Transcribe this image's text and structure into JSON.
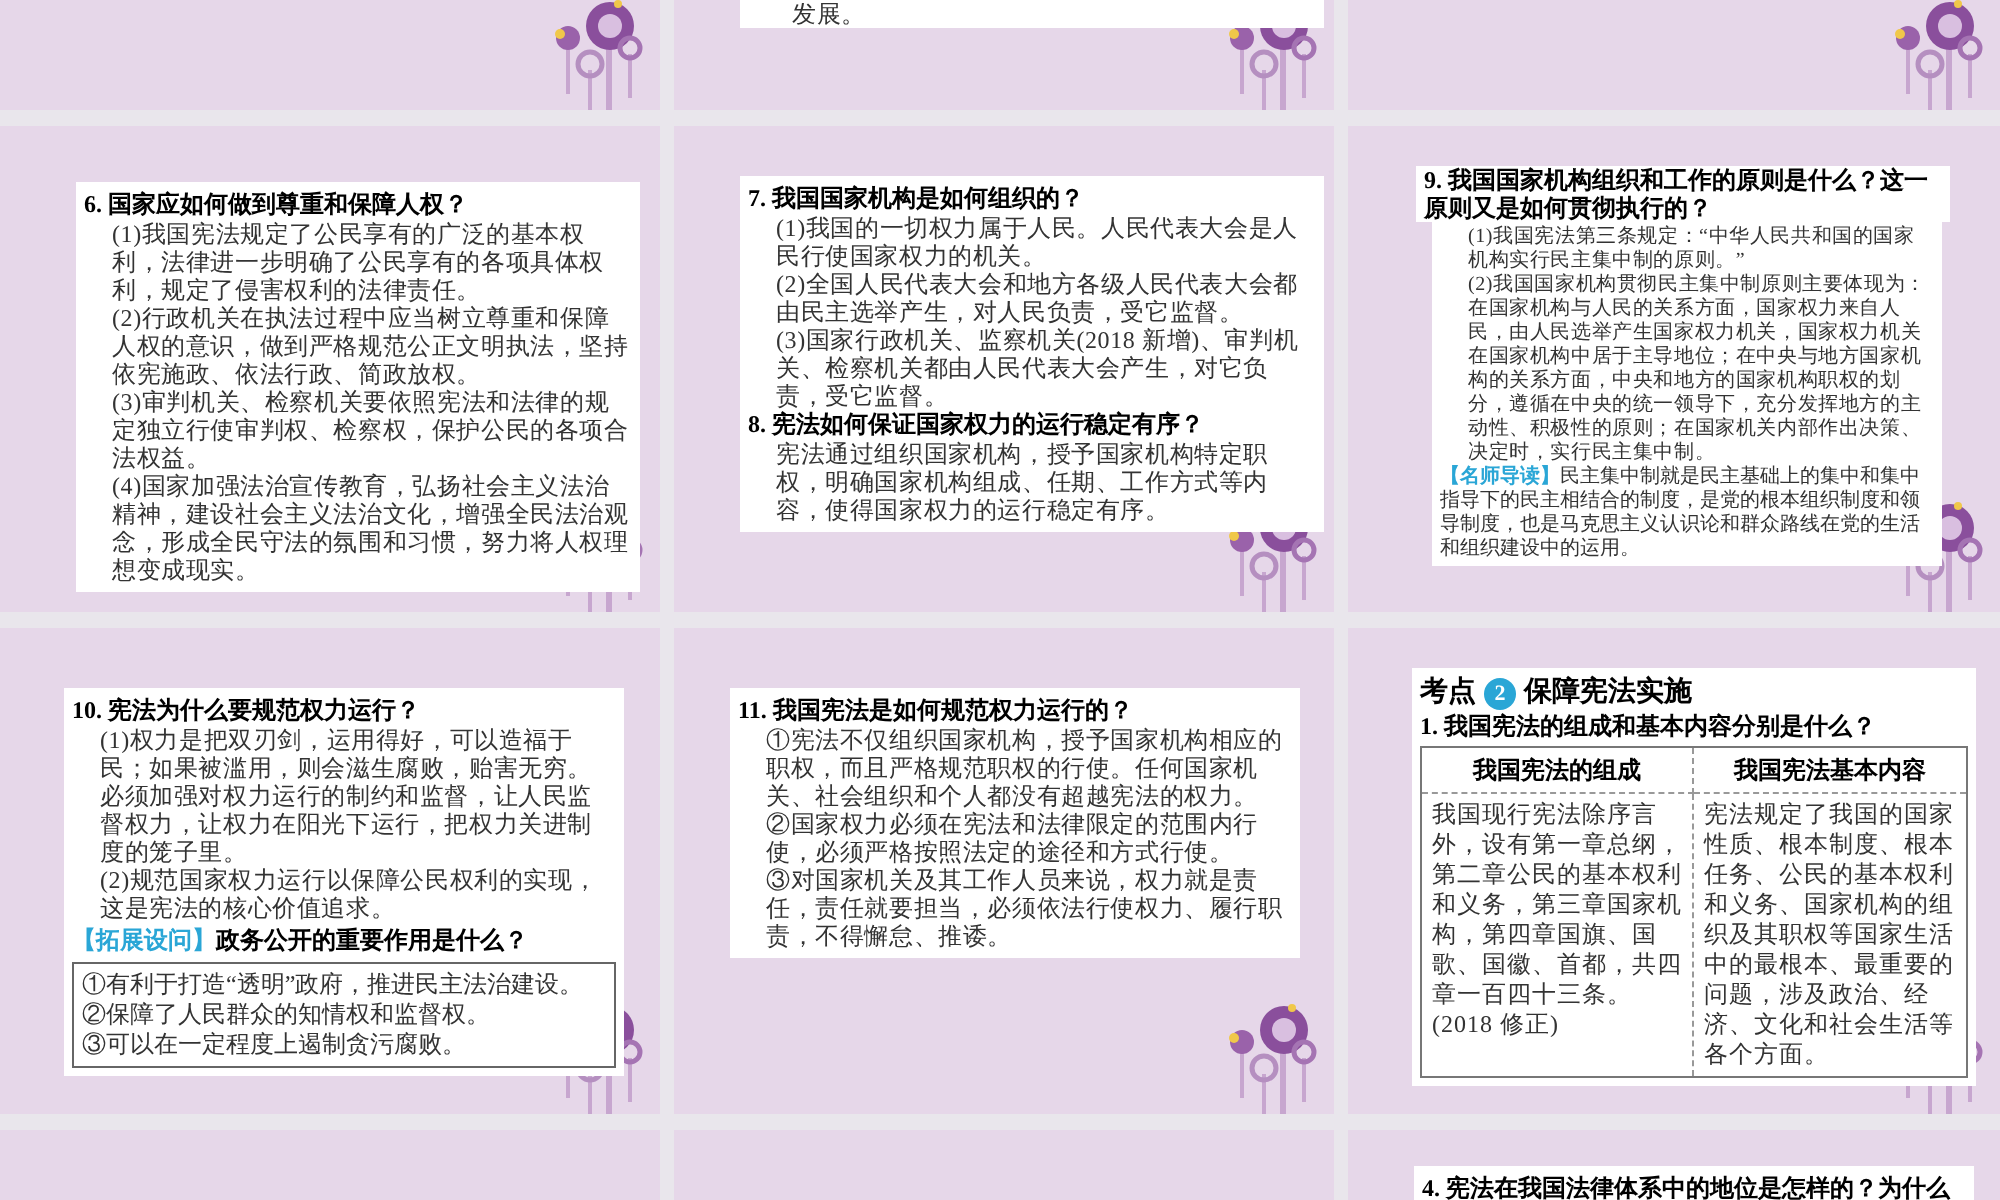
{
  "slides": [
    {
      "flower": true
    },
    {
      "flower": true,
      "blocks": [
        {
          "kind": "paragraph",
          "text": "发展。"
        }
      ]
    },
    {
      "flower": true
    },
    {
      "flower": true,
      "blocks": [
        {
          "kind": "question",
          "text": "6. 国家应如何做到尊重和保障人权？"
        },
        {
          "kind": "paragraph",
          "text": "(1)我国宪法规定了公民享有的广泛的基本权利，法律进一步明确了公民享有的各项具体权利，规定了侵害权利的法律责任。"
        },
        {
          "kind": "paragraph",
          "text": "(2)行政机关在执法过程中应当树立尊重和保障人权的意识，做到严格规范公正文明执法，坚持依宪施政、依法行政、简政放权。"
        },
        {
          "kind": "paragraph",
          "text": "(3)审判机关、检察机关要依照宪法和法律的规定独立行使审判权、检察权，保护公民的各项合法权益。"
        },
        {
          "kind": "paragraph",
          "text": "(4)国家加强法治宣传教育，弘扬社会主义法治精神，建设社会主义法治文化，增强全民法治观念，形成全民守法的氛围和习惯，努力将人权理想变成现实。"
        }
      ]
    },
    {
      "flower": true,
      "blocks": [
        {
          "kind": "question",
          "text": "7. 我国国家机构是如何组织的？"
        },
        {
          "kind": "paragraph",
          "text": "(1)我国的一切权力属于人民。人民代表大会是人民行使国家权力的机关。"
        },
        {
          "kind": "paragraph",
          "text": "(2)全国人民代表大会和地方各级人民代表大会都由民主选举产生，对人民负责，受它监督。"
        },
        {
          "kind": "paragraph",
          "text": "(3)国家行政机关、监察机关(2018 新增)、审判机关、检察机关都由人民代表大会产生，对它负责，受它监督。"
        },
        {
          "kind": "question",
          "text": "8. 宪法如何保证国家权力的运行稳定有序？"
        },
        {
          "kind": "paragraph",
          "text": "宪法通过组织国家机构，授予国家机构特定职权，明确国家机构组成、任期、工作方式等内容，使得国家权力的运行稳定有序。"
        }
      ]
    },
    {
      "flower": true,
      "blocks": [
        {
          "kind": "header",
          "text": "9. 我国国家机构组织和工作的原则是什么？这一原则又是如何贯彻执行的？"
        },
        {
          "kind": "paragraph",
          "text": "(1)我国宪法第三条规定：“中华人民共和国的国家机构实行民主集中制的原则。”"
        },
        {
          "kind": "paragraph",
          "text": "(2)我国国家机构贯彻民主集中制原则主要体现为：在国家机构与人民的关系方面，国家权力来自人民，由人民选举产生国家权力机关，国家权力机关在国家机构中居于主导地位；在中央与地方国家机构的关系方面，中央和地方的国家机构职权的划分，遵循在中央的统一领导下，充分发挥地方的主动性、积极性的原则；在国家机关内部作出决策、决定时，实行民主集中制。"
        },
        {
          "kind": "tip",
          "label": "【名师导读】",
          "text": "民主集中制就是民主基础上的集中和集中指导下的民主相结合的制度，是党的根本组织制度和领导制度，也是马克思主义认识论和群众路线在党的生活和组织建设中的运用。"
        }
      ]
    },
    {
      "flower": true,
      "blocks": [
        {
          "kind": "question",
          "text": "10. 宪法为什么要规范权力运行？"
        },
        {
          "kind": "paragraph",
          "text": "(1)权力是把双刃剑，运用得好，可以造福于民；如果被滥用，则会滋生腐败，贻害无穷。必须加强对权力运行的制约和监督，让人民监督权力，让权力在阳光下运行，把权力关进制度的笼子里。"
        },
        {
          "kind": "paragraph",
          "text": "(2)规范国家权力运行以保障公民权利的实现，这是宪法的核心价值追求。"
        },
        {
          "kind": "tip_question",
          "label": "【拓展设问】",
          "text": "政务公开的重要作用是什么？"
        },
        {
          "kind": "answer_box",
          "items": [
            "①有利于打造“透明”政府，推进民主法治建设。",
            "②保障了人民群众的知情权和监督权。",
            "③可以在一定程度上遏制贪污腐败。"
          ]
        }
      ]
    },
    {
      "flower": true,
      "blocks": [
        {
          "kind": "question",
          "text": "11. 我国宪法是如何规范权力运行的？"
        },
        {
          "kind": "paragraph",
          "text": "①宪法不仅组织国家机构，授予国家机构相应的职权，而且严格规范职权的行使。任何国家机关、社会组织和个人都没有超越宪法的权力。"
        },
        {
          "kind": "paragraph",
          "text": "②国家权力必须在宪法和法律限定的范围内行使，必须严格按照法定的途径和方式行使。"
        },
        {
          "kind": "paragraph",
          "text": "③对国家机关及其工作人员来说，权力就是责任，责任就要担当，必须依法行使权力、履行职责，不得懈怠、推诿。"
        }
      ]
    },
    {
      "flower": true,
      "blocks": [
        {
          "kind": "section",
          "prefix": "考点",
          "badge": "2",
          "text": "保障宪法实施"
        },
        {
          "kind": "question",
          "text": "1. 我国宪法的组成和基本内容分别是什么？"
        },
        {
          "kind": "table",
          "columns": [
            "我国宪法的组成",
            "我国宪法基本内容"
          ],
          "cells": [
            "我国现行宪法除序言外，设有第一章总纲，第二章公民的基本权利和义务，第三章国家机构，第四章国旗、国歌、国徽、首都，共四章一百四十三条。(2018 修正)",
            "宪法规定了我国的国家性质、根本制度、根本任务、公民的基本权利和义务、国家机构的组织及其职权等国家生活中的最根本、最重要的问题，涉及政治、经济、文化和社会生活等各个方面。"
          ]
        }
      ]
    },
    {
      "flower": false
    },
    {
      "flower": false
    },
    {
      "flower": false,
      "blocks": [
        {
          "kind": "question",
          "text": "4. 宪法在我国法律体系中的地位是怎样的？为什么"
        }
      ]
    }
  ]
}
